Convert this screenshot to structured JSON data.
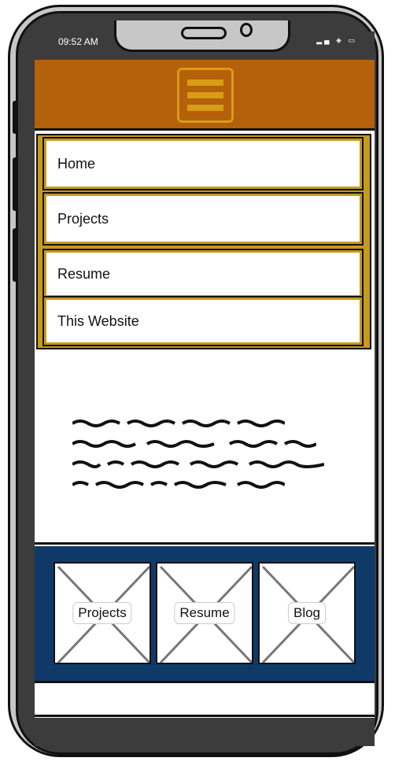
{
  "status_bar": {
    "time": "09:52 AM",
    "icons": "signal-icon wifi-icon battery-icon"
  },
  "header": {
    "menu_icon": "hamburger-menu-icon",
    "bg_color": "#b5600a",
    "accent_color": "#d89c16"
  },
  "nav": {
    "items": [
      {
        "label": "Home"
      },
      {
        "label": "Projects"
      },
      {
        "label": "Resume"
      },
      {
        "label": "This Website"
      }
    ],
    "border_color": "#c69a1d"
  },
  "gallery": {
    "bg_color": "#0f3a68",
    "cards": [
      {
        "label": "Projects",
        "icon": "image-placeholder-icon"
      },
      {
        "label": "Resume",
        "icon": "image-placeholder-icon"
      },
      {
        "label": "Blog",
        "icon": "image-placeholder-icon"
      }
    ]
  }
}
